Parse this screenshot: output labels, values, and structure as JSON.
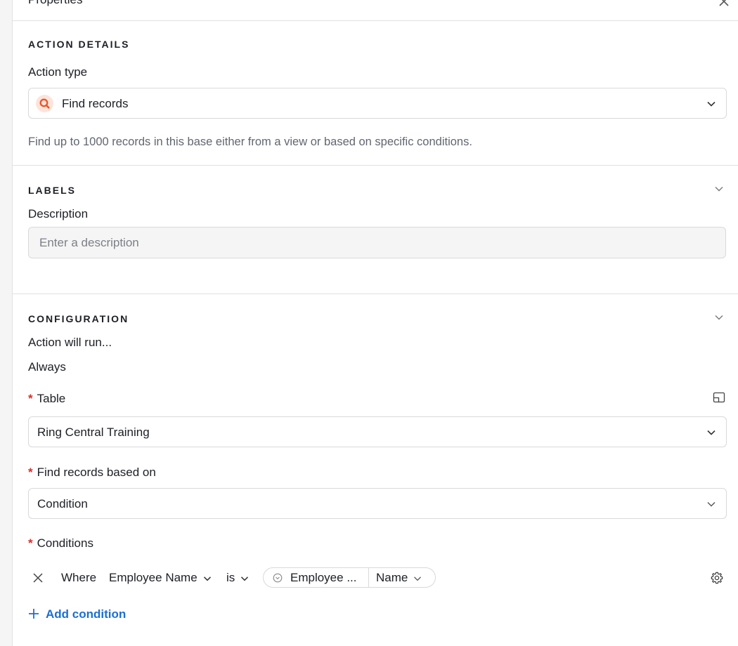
{
  "header": {
    "title": "Properties"
  },
  "action_details": {
    "section_title": "ACTION DETAILS",
    "action_type_label": "Action type",
    "action_type_value": "Find records",
    "action_type_icon": "search-icon",
    "help": "Find up to 1000 records in this base either from a view or based on specific conditions."
  },
  "labels": {
    "section_title": "LABELS",
    "description_label": "Description",
    "description_placeholder": "Enter a description"
  },
  "configuration": {
    "section_title": "CONFIGURATION",
    "run_label": "Action will run...",
    "run_value": "Always",
    "table_label": "Table",
    "table_value": "Ring Central Training",
    "find_based_label": "Find records based on",
    "find_based_value": "Condition",
    "conditions_label": "Conditions",
    "condition": {
      "where": "Where",
      "field": "Employee Name",
      "operator": "is",
      "value_token": "Employee ...",
      "value_subfield": "Name"
    },
    "add_condition": "Add condition"
  },
  "colors": {
    "accent": "#1b6fd1",
    "required": "#dc2b2b",
    "icon_bg": "#fde4da",
    "icon_fg": "#e5572b"
  }
}
